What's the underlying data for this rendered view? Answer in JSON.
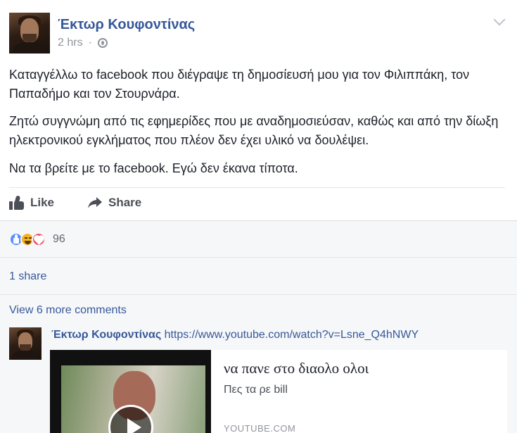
{
  "post": {
    "author": "Έκτωρ Κουφοντίνας",
    "time": "2 hrs",
    "paragraphs": [
      "Καταγγέλλω το facebook που διέγραψε τη δημοσίευσή μου για τον Φιλιππάκη, τον Παπαδήμο και τον Στουρνάρα.",
      "Ζητώ συγγνώμη από τις εφημερίδες που με αναδημοσιεύσαν, καθώς και από την δίωξη ηλεκτρονικού εγκλήματος που πλέον δεν έχει υλικό να δουλέψει.",
      "Να τα βρείτε με το facebook. Εγώ δεν έκανα τίποτα."
    ],
    "icons": {
      "privacy": "globe-icon",
      "menu": "chevron-down-icon"
    }
  },
  "actions": {
    "like_label": "Like",
    "share_label": "Share"
  },
  "reactions": {
    "types": [
      "like",
      "haha",
      "love"
    ],
    "count": "96"
  },
  "shares": {
    "label": "1 share"
  },
  "comments": {
    "more_label": "View 6 more comments",
    "items": [
      {
        "author": "Έκτωρ Κουφοντίνας",
        "link": "https://www.youtube.com/watch?v=Lsne_Q4hNWY",
        "card": {
          "title": "να πανε στο διαολο ολοι",
          "description": "Πες τα ρε bill",
          "source": "YOUTUBE.COM"
        }
      }
    ]
  },
  "colors": {
    "link": "#365899",
    "text": "#1d2129",
    "muted": "#90949c",
    "footer_bg": "#f6f7f9",
    "like_reaction": "#5890ff",
    "haha_reaction": "#f7b125",
    "love_reaction": "#f25268"
  }
}
